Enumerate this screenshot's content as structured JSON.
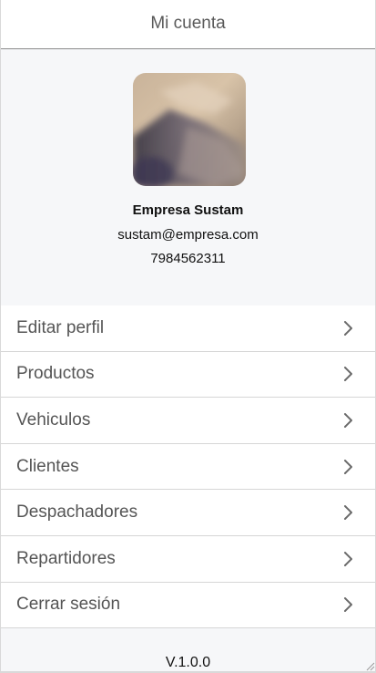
{
  "header": {
    "title": "Mi cuenta"
  },
  "profile": {
    "name": "Empresa Sustam",
    "email": "sustam@empresa.com",
    "phone": "7984562311",
    "avatar_icon": "avatar-photo"
  },
  "menu": {
    "items": [
      {
        "label": "Editar perfil",
        "icon": "chevron-right-icon"
      },
      {
        "label": "Productos",
        "icon": "chevron-right-icon"
      },
      {
        "label": "Vehiculos",
        "icon": "chevron-right-icon"
      },
      {
        "label": "Clientes",
        "icon": "chevron-right-icon"
      },
      {
        "label": "Despachadores",
        "icon": "chevron-right-icon"
      },
      {
        "label": "Repartidores",
        "icon": "chevron-right-icon"
      },
      {
        "label": "Cerrar sesión",
        "icon": "chevron-right-icon"
      }
    ]
  },
  "footer": {
    "version": "V.1.0.0"
  },
  "colors": {
    "background": "#f6f7f9",
    "header_border": "#8a8a8a",
    "divider": "#d6d6d6",
    "menu_text": "#555555"
  }
}
